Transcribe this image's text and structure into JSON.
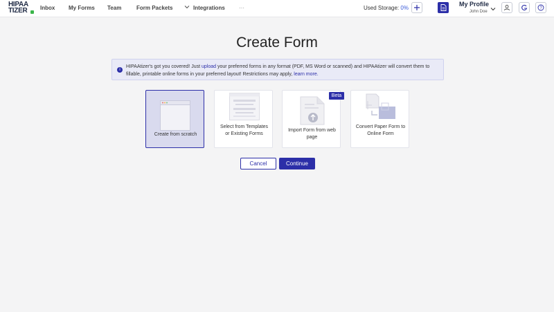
{
  "header": {
    "logo_line1": "HIPAA",
    "logo_line2": "TIZER",
    "nav": [
      "Inbox",
      "My Forms",
      "Team",
      "Form Packets",
      "Integrations",
      "···"
    ],
    "storage_label": "Used Storage:",
    "storage_value": "0%",
    "profile_name": "My Profile",
    "profile_user": "John Doe"
  },
  "main": {
    "title": "Create Form",
    "info": {
      "text1": "HIPAAtizer's got you covered! Just ",
      "link1": "upload",
      "text2": " your preferred forms in any format (PDF, MS Word or scanned) and HIPAAtizer will convert them to fillable, printable online forms in your preferred layout! Restrictions may apply, ",
      "link2": "learn more."
    },
    "cards": [
      {
        "label": "Create from scratch",
        "selected": true
      },
      {
        "label": "Select from Templates or Existing Forms",
        "selected": false
      },
      {
        "label": "Import Form from web page",
        "selected": false,
        "badge": "Beta"
      },
      {
        "label": "Convert Paper Form to Online Form",
        "selected": false
      }
    ],
    "cancel_label": "Cancel",
    "continue_label": "Continue"
  },
  "colors": {
    "accent": "#2c2fa8",
    "selected_card": "#d9daee",
    "info_bg": "#e9eaf7",
    "logo_green": "#3bb54a"
  }
}
